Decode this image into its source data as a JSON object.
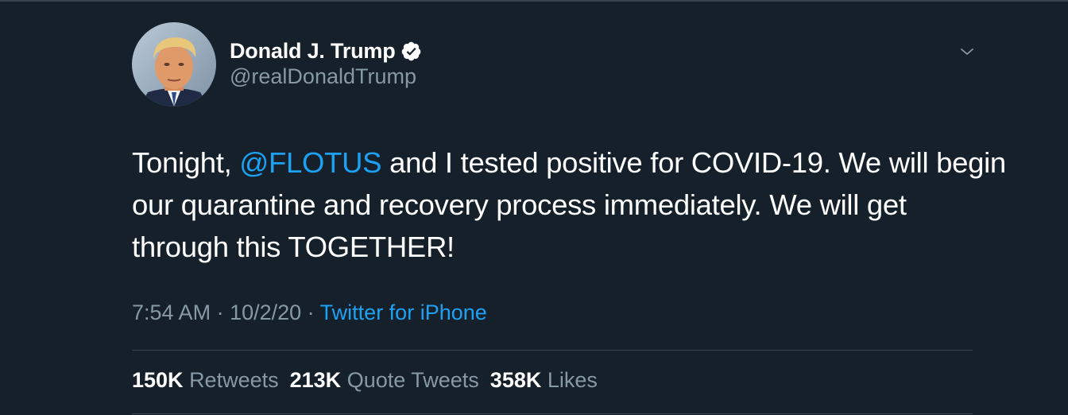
{
  "colors": {
    "background": "#15202b",
    "primary_text": "#ffffff",
    "secondary_text": "#8899a6",
    "accent": "#1da1f2",
    "divider": "#38444d"
  },
  "author": {
    "display_name": "Donald J. Trump",
    "handle": "@realDonaldTrump",
    "verified_icon": "verified-badge-icon",
    "avatar_icon": "profile-photo"
  },
  "menu_icon": "chevron-down-icon",
  "tweet": {
    "text_before_mention": "Tonight, ",
    "mention": "@FLOTUS",
    "text_after_mention": " and I tested positive for COVID-19. We will begin our quarantine and recovery process immediately. We will get through this TOGETHER!"
  },
  "meta": {
    "time": "7:54 AM",
    "separator1": " · ",
    "date": "10/2/20",
    "separator2": " · ",
    "source": "Twitter for iPhone"
  },
  "stats": {
    "retweets": {
      "count": "150K",
      "label": "Retweets"
    },
    "quote_tweets": {
      "count": "213K",
      "label": "Quote Tweets"
    },
    "likes": {
      "count": "358K",
      "label": "Likes"
    }
  }
}
